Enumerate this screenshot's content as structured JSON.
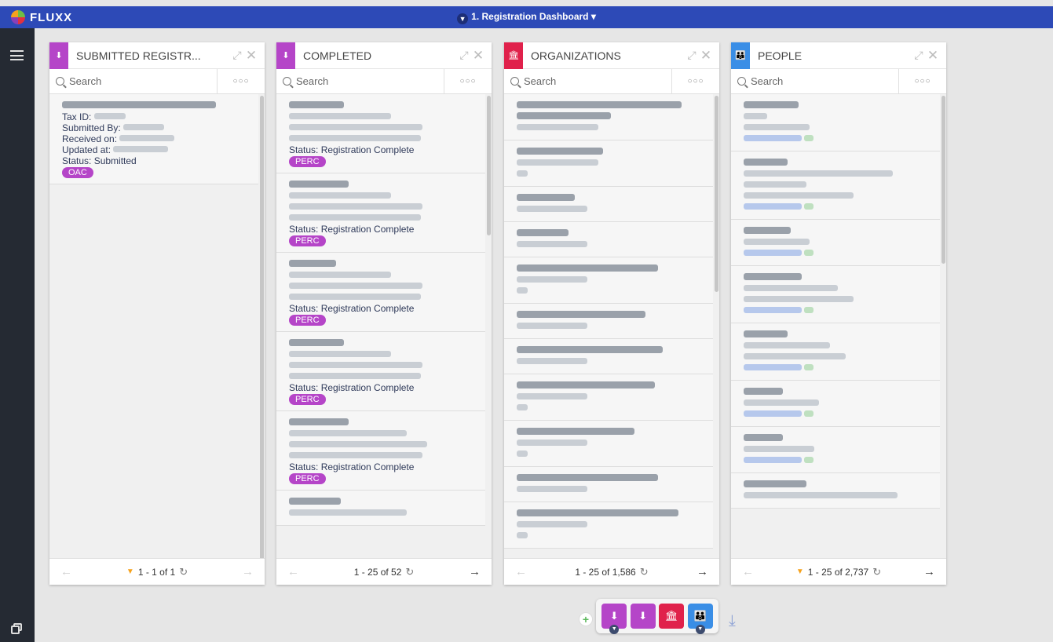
{
  "app": {
    "logo_text": "FLUXX",
    "dashboard_title": "1. Registration Dashboard ▾"
  },
  "colors": {
    "purple": "#b545c8",
    "red": "#e0214b",
    "blue": "#3a8ee6",
    "topbar": "#2d4ab7"
  },
  "icons": {
    "download": "⬇",
    "bank": "🏛",
    "people": "👪",
    "pin": "⤢",
    "close": "✕",
    "more": "○○○",
    "refresh": "↻",
    "prev": "←",
    "next": "→",
    "filter": "▼",
    "add": "+",
    "download_all": "⤓"
  },
  "search": {
    "placeholder": "Search"
  },
  "cards": [
    {
      "title": "SUBMITTED REGISTR...",
      "color": "#b545c8",
      "pager": "1 - 1 of 1",
      "filtered": true,
      "items": [
        {
          "tax_label": "Tax ID:",
          "submitted_label": "Submitted By:",
          "received_label": "Received on:",
          "updated_label": "Updated at:",
          "status": "Status: Submitted",
          "badge": "OAC"
        }
      ]
    },
    {
      "title": "COMPLETED",
      "color": "#b545c8",
      "pager": "1 - 25 of 52",
      "filtered": false,
      "items": [
        {
          "status": "Status: Registration Complete",
          "badge": "PERC"
        },
        {
          "status": "Status: Registration Complete",
          "badge": "PERC"
        },
        {
          "status": "Status: Registration Complete",
          "badge": "PERC"
        },
        {
          "status": "Status: Registration Complete",
          "badge": "PERC"
        },
        {
          "status": "Status: Registration Complete",
          "badge": "PERC"
        }
      ]
    },
    {
      "title": "ORGANIZATIONS",
      "color": "#e0214b",
      "pager": "1 - 25 of 1,586",
      "filtered": false
    },
    {
      "title": "PEOPLE",
      "color": "#3a8ee6",
      "pager": "1 - 25 of 2,737",
      "filtered": true
    }
  ]
}
